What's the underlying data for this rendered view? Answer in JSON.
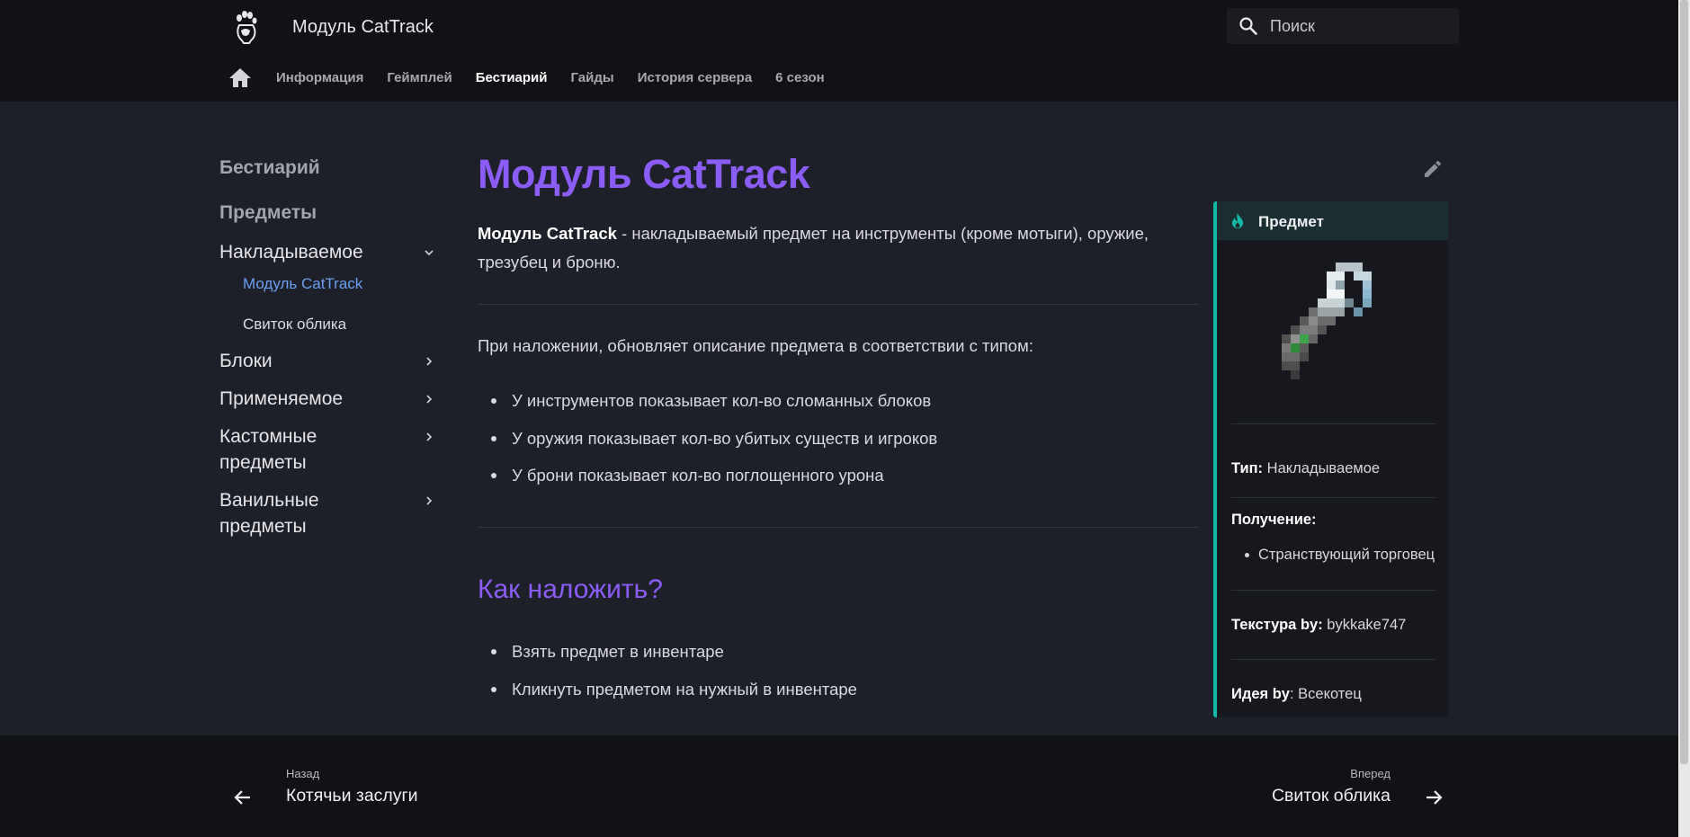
{
  "header": {
    "site_title": "Модуль CatTrack",
    "logo_icon": "cat-paw-icon",
    "search_placeholder": "Поиск",
    "tabs": [
      {
        "label": "Информация",
        "active": false
      },
      {
        "label": "Геймплей",
        "active": false
      },
      {
        "label": "Бестиарий",
        "active": true
      },
      {
        "label": "Гайды",
        "active": false
      },
      {
        "label": "История сервера",
        "active": false
      },
      {
        "label": "6 сезон",
        "active": false
      }
    ]
  },
  "sidebar": {
    "sections": [
      "Бестиарий",
      "Предметы"
    ],
    "items": [
      {
        "label": "Накладываемое",
        "expanded": true
      },
      {
        "label": "Блоки",
        "expanded": false
      },
      {
        "label": "Применяемое",
        "expanded": false
      },
      {
        "label": "Кастомные предметы",
        "expanded": false
      },
      {
        "label": "Ванильные предметы",
        "expanded": false
      }
    ],
    "subitems": [
      {
        "label": "Модуль CatTrack",
        "active": true
      },
      {
        "label": "Свиток облика",
        "active": false
      }
    ]
  },
  "main": {
    "title": "Модуль CatTrack",
    "intro_bold": "Модуль CatTrack",
    "intro_rest": " - накладываемый предмет на инструменты (кроме мотыги), оружие, трезубец и броню.",
    "description": "При наложении, обновляет описание предмета в соответствии с типом:",
    "bullets": [
      "У инструментов показывает кол-во сломанных блоков",
      "У оружия показывает кол-во убитых существ и игроков",
      "У брони показывает кол-во поглощенного урона"
    ],
    "howto_title": "Как наложить?",
    "howto_steps": [
      "Взять предмет в инвентаре",
      "Кликнуть предметом на нужный в инвентаре"
    ]
  },
  "infobox": {
    "header": "Предмет",
    "type_key": "Тип:",
    "type_value": " Накладываемое",
    "obtain_key": "Получение:",
    "obtain_items": [
      "Странствующий торговец"
    ],
    "texture_key": "Текстура by:",
    "texture_value": " bykkake747",
    "idea_key": "Идея by",
    "idea_value": ": Всекотец"
  },
  "footer": {
    "prev_caption": "Назад",
    "prev_title": "Котячьи заслуги",
    "next_caption": "Вперед",
    "next_title": "Свиток облика"
  },
  "colors": {
    "accent_purple": "#8b5cf6",
    "accent_teal": "#14b8a6",
    "link_blue": "#6b9ff2",
    "background": "#1e2029",
    "header_bg": "#111216"
  }
}
